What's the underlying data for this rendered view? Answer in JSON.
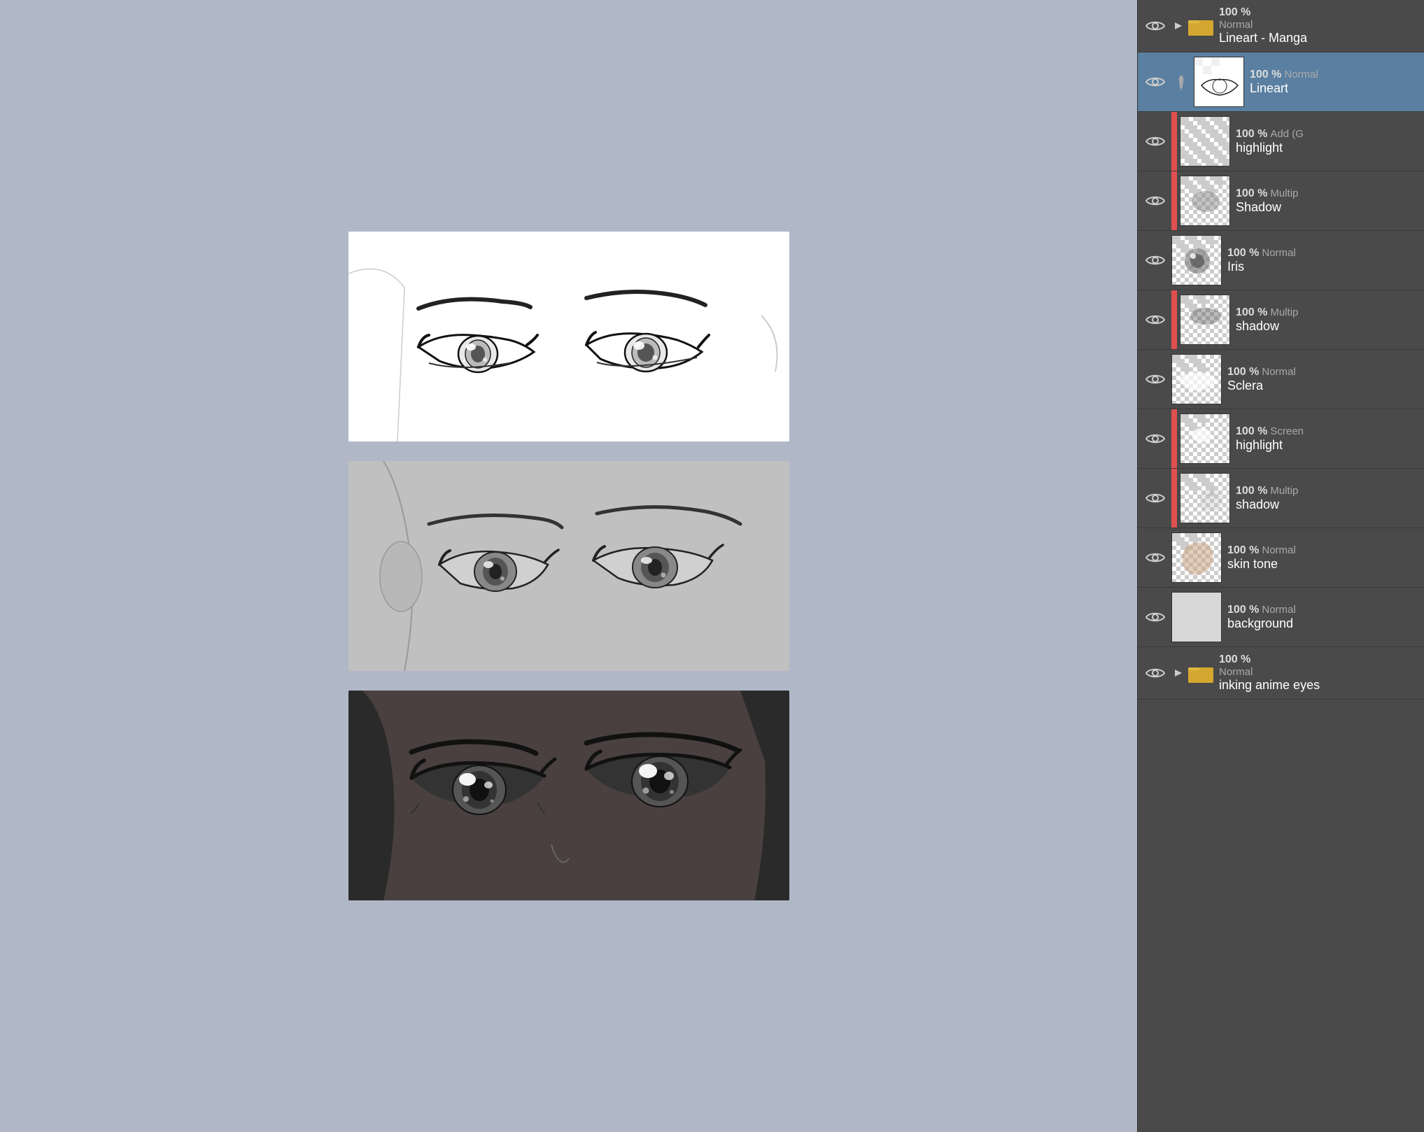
{
  "canvas": {
    "panels": [
      {
        "id": "panel-1",
        "style": "white",
        "label": "manga lineart eyes"
      },
      {
        "id": "panel-2",
        "style": "gray",
        "label": "manga gray eyes"
      },
      {
        "id": "panel-3",
        "style": "dark",
        "label": "anime dark eyes"
      }
    ]
  },
  "layers": {
    "top_folder": {
      "opacity": "100 %",
      "blend": "Normal",
      "name": "Lineart - Manga"
    },
    "items": [
      {
        "id": "lineart",
        "opacity": "100 %",
        "blend": "Normal",
        "name": "Lineart",
        "selected": true,
        "has_pen": true,
        "has_color_dot": false
      },
      {
        "id": "highlight",
        "opacity": "100 %",
        "blend": "Add (G",
        "name": "highlight",
        "selected": false,
        "has_pen": false,
        "has_color_dot": true
      },
      {
        "id": "shadow1",
        "opacity": "100 %",
        "blend": "Multip",
        "name": "Shadow",
        "selected": false,
        "has_pen": false,
        "has_color_dot": true
      },
      {
        "id": "iris",
        "opacity": "100 %",
        "blend": "Normal",
        "name": "Iris",
        "selected": false,
        "has_pen": false,
        "has_color_dot": false
      },
      {
        "id": "shadow2",
        "opacity": "100 %",
        "blend": "Multip",
        "name": "shadow",
        "selected": false,
        "has_pen": false,
        "has_color_dot": true
      },
      {
        "id": "sclera",
        "opacity": "100 %",
        "blend": "Normal",
        "name": "Sclera",
        "selected": false,
        "has_pen": false,
        "has_color_dot": false
      },
      {
        "id": "screen-highlight",
        "opacity": "100 %",
        "blend": "Screen",
        "name": "highlight",
        "selected": false,
        "has_pen": false,
        "has_color_dot": true
      },
      {
        "id": "shadow3",
        "opacity": "100 %",
        "blend": "Multip",
        "name": "shadow",
        "selected": false,
        "has_pen": false,
        "has_color_dot": true
      },
      {
        "id": "skin-tone",
        "opacity": "100 %",
        "blend": "Normal",
        "name": "skin tone",
        "selected": false,
        "has_pen": false,
        "has_color_dot": false
      },
      {
        "id": "background",
        "opacity": "100 %",
        "blend": "Normal",
        "name": "background",
        "selected": false,
        "has_pen": false,
        "has_color_dot": false,
        "is_white": true
      }
    ],
    "bottom_folder": {
      "opacity": "100 %",
      "blend": "Normal",
      "name": "inking anime eyes"
    }
  }
}
